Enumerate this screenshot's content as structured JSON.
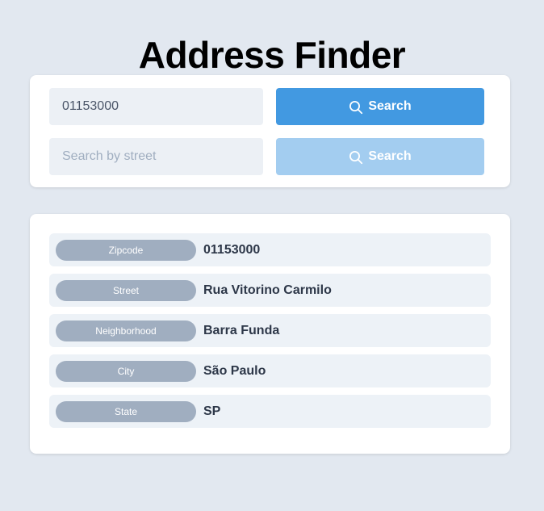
{
  "title": "Address Finder",
  "search": {
    "zipcode_value": "01153000",
    "street_placeholder": "Search by street",
    "zipcode_button_label": "Search",
    "street_button_label": "Search",
    "button_icon": "search-icon"
  },
  "result": {
    "rows": [
      {
        "label": "Zipcode",
        "value": "01153000"
      },
      {
        "label": "Street",
        "value": "Rua Vitorino Carmilo"
      },
      {
        "label": "Neighborhood",
        "value": "Barra Funda"
      },
      {
        "label": "City",
        "value": "São Paulo"
      },
      {
        "label": "State",
        "value": "SP"
      }
    ]
  },
  "colors": {
    "background": "#e2e8f0",
    "primary_button": "#4299e1",
    "disabled_button": "#a3cdf0",
    "badge": "#a0aec0",
    "row_background": "#edf2f7"
  }
}
